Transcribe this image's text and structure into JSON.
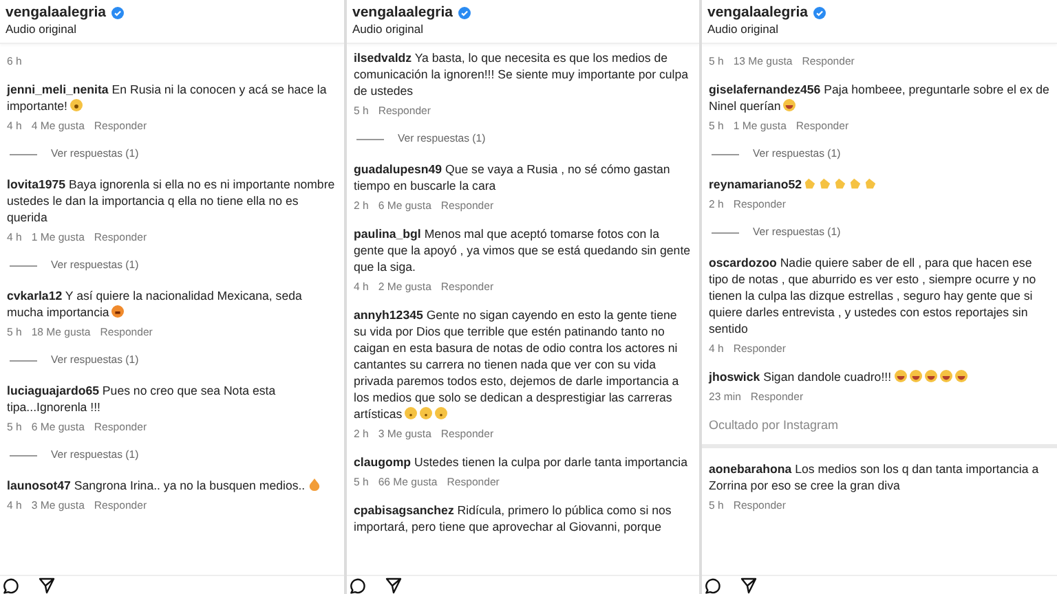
{
  "panels": [
    {
      "header": {
        "user": "vengalaalegria",
        "verified": true,
        "subtitle": "Audio original"
      },
      "items": [
        {
          "kind": "time",
          "time": "6 h"
        },
        {
          "kind": "comment",
          "user": "jenni_meli_nenita",
          "text": "En Rusia ni la conocen y acá se hace la importante!",
          "emojis": [
            {
              "kind": "face"
            }
          ],
          "time": "4 h",
          "likes": "4 Me gusta",
          "reply": "Responder"
        },
        {
          "kind": "replies",
          "label": "Ver respuestas (1)"
        },
        {
          "kind": "comment",
          "user": "lovita1975",
          "text": "Baya ignorenla si ella no es ni importante nombre ustedes le dan la importancia q ella no tiene ella no es querida",
          "time": "4 h",
          "likes": "1 Me gusta",
          "reply": "Responder"
        },
        {
          "kind": "replies",
          "label": "Ver respuestas (1)"
        },
        {
          "kind": "comment",
          "user": "cvkarla12",
          "text": "Y así quiere la nacionalidad Mexicana, seda mucha importancia",
          "emojis": [
            {
              "kind": "angry"
            }
          ],
          "time": "5 h",
          "likes": "18 Me gusta",
          "reply": "Responder"
        },
        {
          "kind": "replies",
          "label": "Ver respuestas (1)"
        },
        {
          "kind": "comment",
          "user": "luciaguajardo65",
          "text": "Pues no creo que sea Nota esta tipa...Ignorenla !!!",
          "time": "5 h",
          "likes": "6 Me gusta",
          "reply": "Responder"
        },
        {
          "kind": "replies",
          "label": "Ver respuestas (1)"
        },
        {
          "kind": "comment",
          "user": "launosot47",
          "text": "Sangrona Irina.. ya no la busquen medios..",
          "emojis": [
            {
              "kind": "fire"
            }
          ],
          "time": "4 h",
          "likes": "3 Me gusta",
          "reply": "Responder"
        }
      ]
    },
    {
      "header": {
        "user": "vengalaalegria",
        "verified": true,
        "subtitle": "Audio original"
      },
      "items": [
        {
          "kind": "comment",
          "user": "ilsedvaldz",
          "text": "Ya basta, lo que necesita es que los medios de comunicación la ignoren!!! Se siente muy importante por culpa de ustedes",
          "time": "5 h",
          "reply": "Responder"
        },
        {
          "kind": "replies",
          "label": "Ver respuestas (1)"
        },
        {
          "kind": "comment",
          "user": "guadalupesn49",
          "text": "Que se vaya a Rusia , no sé cómo gastan tiempo en buscarle la cara",
          "time": "2 h",
          "likes": "6 Me gusta",
          "reply": "Responder"
        },
        {
          "kind": "comment",
          "user": "paulina_bgl",
          "text": "Menos mal que aceptó tomarse fotos con la gente que la apoyó , ya vimos que se está quedando sin gente que la siga.",
          "time": "4 h",
          "likes": "2 Me gusta",
          "reply": "Responder"
        },
        {
          "kind": "comment",
          "user": "annyh12345",
          "text": "Gente no sigan cayendo en esto la gente tiene su vida por Dios que terrible que estén patinando tanto no caigan en esta basura de notas de odio contra los actores ni cantantes su carrera no tienen nada que ver con su vida privada paremos todos esto, dejemos de darle importancia a los medios que solo se dedican a desprestigiar las carreras artísticas",
          "emojis": [
            {
              "kind": "sad"
            },
            {
              "kind": "sad"
            },
            {
              "kind": "sad"
            }
          ],
          "time": "2 h",
          "likes": "3 Me gusta",
          "reply": "Responder"
        },
        {
          "kind": "comment",
          "user": "claugomp",
          "text": "Ustedes tienen la culpa por darle tanta importancia",
          "time": "5 h",
          "likes": "66 Me gusta",
          "reply": "Responder"
        },
        {
          "kind": "comment",
          "user": "cpabisagsanchez",
          "text": "Ridícula, primero lo pública como si nos importará, pero tiene que aprovechar al Giovanni, porque"
        }
      ]
    },
    {
      "header": {
        "user": "vengalaalegria",
        "verified": true,
        "subtitle": "Audio original"
      },
      "items": [
        {
          "kind": "meta",
          "time": "5 h",
          "likes": "13 Me gusta",
          "reply": "Responder"
        },
        {
          "kind": "comment",
          "user": "giselafernandez456",
          "text": "Paja hombeee, preguntarle sobre el ex de Ninel querían",
          "emojis": [
            {
              "kind": "laugh"
            }
          ],
          "time": "5 h",
          "likes": "1 Me gusta",
          "reply": "Responder"
        },
        {
          "kind": "replies",
          "label": "Ver respuestas (1)"
        },
        {
          "kind": "comment",
          "user": "reynamariano52",
          "emojis": [
            {
              "kind": "clap"
            },
            {
              "kind": "clap"
            },
            {
              "kind": "clap"
            },
            {
              "kind": "clap"
            },
            {
              "kind": "clap"
            }
          ],
          "time": "2 h",
          "reply": "Responder"
        },
        {
          "kind": "replies",
          "label": "Ver respuestas (1)"
        },
        {
          "kind": "comment",
          "user": "oscardozoo",
          "text": "Nadie quiere saber de ell , para que hacen ese tipo de notas , que aburrido es ver esto , siempre ocurre y no tienen la culpa las dizque estrellas , seguro hay gente que si quiere darles entrevista , y ustedes con estos reportajes sin sentido",
          "time": "4 h",
          "reply": "Responder"
        },
        {
          "kind": "comment",
          "user": "jhoswick",
          "text": "Sigan dandole cuadro!!!",
          "emojis": [
            {
              "kind": "laugh"
            },
            {
              "kind": "laugh"
            },
            {
              "kind": "laugh"
            },
            {
              "kind": "laugh"
            },
            {
              "kind": "laugh"
            }
          ],
          "time": "23 min",
          "reply": "Responder"
        },
        {
          "kind": "hidden",
          "label": "Ocultado por Instagram"
        },
        {
          "kind": "comment",
          "user": "aonebarahona",
          "text": "Los medios son los q dan tanta importancia a Zorrina por eso se cree la gran diva",
          "time": "5 h",
          "reply": "Responder"
        }
      ]
    }
  ]
}
